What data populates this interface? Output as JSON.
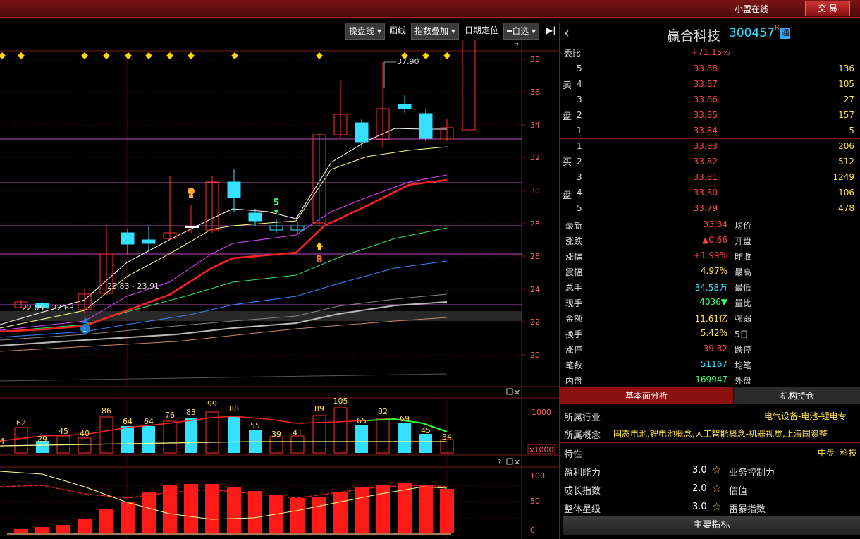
{
  "topbar": {
    "alliance": "小盟在线",
    "trade": "交 易"
  },
  "toolbar": {
    "items": [
      "操盘线",
      "画线",
      "指数叠加",
      "日期定位",
      "自选"
    ],
    "help": "?"
  },
  "chart": {
    "price_ticks": [
      "38",
      "36",
      "34",
      "32",
      "30",
      "28",
      "26",
      "24",
      "22",
      "20"
    ],
    "annotations": {
      "high": "37.90",
      "range1": "23.83 - 23.91",
      "range2": "22.05 - 22.63",
      "signal_s": "S",
      "signal_b": "B",
      "marker_1": "1"
    },
    "volume_ticks": [
      "1000",
      "x1000"
    ],
    "volume_labels": [
      "4",
      "62",
      "29",
      "45",
      "40",
      "86",
      "64",
      "64",
      "76",
      "83",
      "99",
      "88",
      "55",
      "39",
      "41",
      "89",
      "105",
      "65",
      "82",
      "69",
      "45",
      "34"
    ],
    "indicator_ticks": [
      "100",
      "50",
      "0"
    ],
    "panel_help": "?"
  },
  "quote": {
    "name": "赢合科技",
    "code": "300457",
    "badge_r": "R",
    "badge_tong": "通",
    "weibi_label": "委比",
    "weibi": "+71.15%",
    "sell_label": [
      "卖",
      "盘"
    ],
    "buy_label": [
      "买",
      "盘"
    ],
    "sell": [
      {
        "lvl": "5",
        "price": "33.88",
        "vol": "136"
      },
      {
        "lvl": "4",
        "price": "33.87",
        "vol": "105"
      },
      {
        "lvl": "3",
        "price": "33.86",
        "vol": "27"
      },
      {
        "lvl": "2",
        "price": "33.85",
        "vol": "157"
      },
      {
        "lvl": "1",
        "price": "33.84",
        "vol": "5"
      }
    ],
    "buy": [
      {
        "lvl": "1",
        "price": "33.83",
        "vol": "206"
      },
      {
        "lvl": "2",
        "price": "33.82",
        "vol": "512"
      },
      {
        "lvl": "3",
        "price": "33.81",
        "vol": "1249"
      },
      {
        "lvl": "4",
        "price": "33.80",
        "vol": "106"
      },
      {
        "lvl": "5",
        "price": "33.79",
        "vol": "478"
      }
    ],
    "stats": [
      {
        "l": "最新",
        "v": "33.84",
        "c": "red",
        "r": "均价"
      },
      {
        "l": "涨跌",
        "v": "▲0.66",
        "c": "red",
        "r": "开盘"
      },
      {
        "l": "涨幅",
        "v": "+1.99%",
        "c": "red",
        "r": "昨收"
      },
      {
        "l": "震幅",
        "v": "4.97%",
        "c": "yel",
        "r": "最高"
      },
      {
        "l": "总手",
        "v": "34.58万",
        "c": "cyan",
        "r": "最低"
      },
      {
        "l": "现手",
        "v": "4036▼",
        "c": "grn",
        "r": "量比"
      },
      {
        "l": "金额",
        "v": "11.61亿",
        "c": "yel",
        "r": "强弱"
      },
      {
        "l": "换手",
        "v": "5.42%",
        "c": "yel",
        "r": "5日"
      },
      {
        "l": "涨停",
        "v": "39.82",
        "c": "red",
        "r": "跌停"
      },
      {
        "l": "笔数",
        "v": "51167",
        "c": "cyan",
        "r": "均笔"
      },
      {
        "l": "内盘",
        "v": "169947",
        "c": "grn",
        "r": "外盘"
      }
    ],
    "tabs": [
      "基本面分析",
      "机构持仓"
    ],
    "industry_label": "所属行业",
    "industry": "电气设备-电池-锂电专",
    "concept_label": "所属概念",
    "concept": "固态电池,锂电池概念,人工智能概念-机器视觉,上海国资整",
    "trait_label": "特性",
    "trait": "中盘  科技",
    "ratings": [
      {
        "l": "盈利能力",
        "v": "3.0",
        "r": "业务控制力"
      },
      {
        "l": "成长指数",
        "v": "2.0",
        "r": "估值"
      },
      {
        "l": "整体星级",
        "v": "3.0",
        "r": "雷暴指数"
      }
    ],
    "main_index": "主要指标"
  },
  "colors": {
    "up": "#ff4444",
    "down": "#33e0ff",
    "accent": "#7a1414"
  }
}
